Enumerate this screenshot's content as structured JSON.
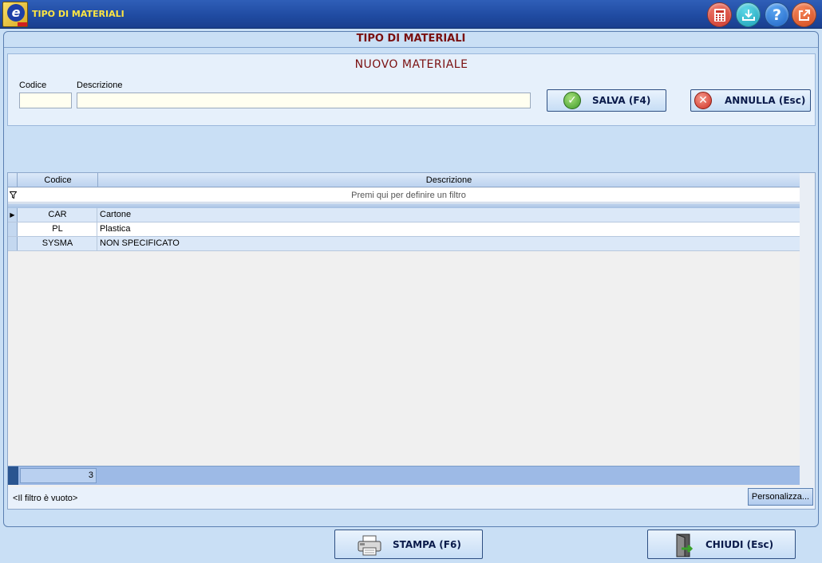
{
  "window": {
    "title": "TIPO DI MATERIALI",
    "toolbar_icons": [
      "calculator-icon",
      "download-icon",
      "help-icon",
      "exit-icon"
    ]
  },
  "main": {
    "header": "TIPO DI MATERIALI",
    "form": {
      "title": "NUOVO MATERIALE",
      "codice_label": "Codice",
      "descrizione_label": "Descrizione",
      "codice_value": "",
      "descrizione_value": "",
      "save_label": "SALVA (F4)",
      "cancel_label": "ANNULLA  (Esc)"
    },
    "grid": {
      "columns": [
        "Codice",
        "Descrizione"
      ],
      "filter_hint": "Premi qui per definire un filtro",
      "rows": [
        {
          "codice": "CAR",
          "descrizione": "Cartone"
        },
        {
          "codice": "PL",
          "descrizione": "Plastica"
        },
        {
          "codice": "SYSMA",
          "descrizione": "NON SPECIFICATO"
        }
      ],
      "count": "3"
    },
    "status": {
      "filter_text": "<Il filtro è vuoto>",
      "personalizza_label": "Personalizza..."
    }
  },
  "footer": {
    "print_label": "STAMPA (F6)",
    "close_label": "CHIUDI  (Esc)"
  },
  "colors": {
    "title_text": "#ffe642",
    "header_text": "#7a1010",
    "accent": "#1f4aa0"
  }
}
